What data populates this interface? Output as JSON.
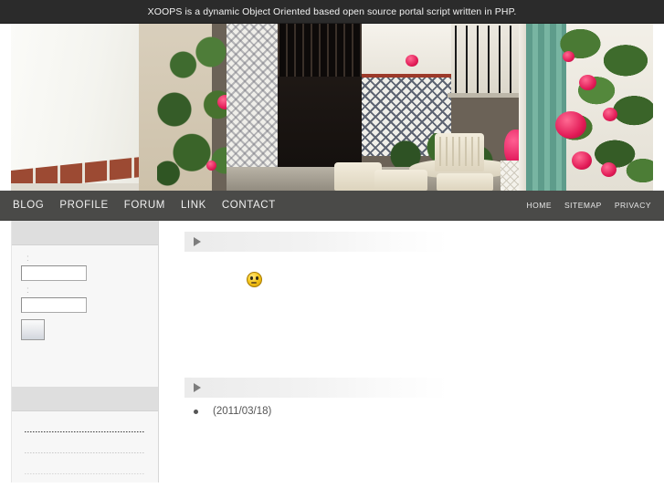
{
  "topbar": {
    "announcement": "XOOPS is a dynamic Object Oriented based open source portal script written in PHP."
  },
  "banner": {
    "alt": "patio-photo-banner",
    "description": "Patio with white plastic table and chairs, tiled wall, pink geranium and bougainvillea flowers"
  },
  "nav": {
    "primary": [
      {
        "label": "BLOG",
        "name": "nav-item-blog"
      },
      {
        "label": "PROFILE",
        "name": "nav-item-profile"
      },
      {
        "label": "FORUM",
        "name": "nav-item-forum"
      },
      {
        "label": "LINK",
        "name": "nav-item-link"
      },
      {
        "label": "CONTACT",
        "name": "nav-item-contact"
      }
    ],
    "secondary": [
      {
        "label": "HOME",
        "name": "nav-item-home"
      },
      {
        "label": "SITEMAP",
        "name": "nav-item-sitemap"
      },
      {
        "label": "PRIVACY",
        "name": "nav-item-privacy"
      }
    ]
  },
  "sidebar": {
    "login_block": {
      "title": "",
      "username_label": ":",
      "username_value": "",
      "username_placeholder": "",
      "password_label": ":",
      "password_value": "",
      "password_placeholder": "",
      "submit_label": ""
    },
    "links_block": {
      "title": ""
    }
  },
  "main": {
    "article_block": {
      "title": "",
      "body_text": "",
      "emoticon": "smiley-face"
    },
    "news_block": {
      "title": "",
      "items": [
        {
          "title": "",
          "date": "(2011/03/18)"
        }
      ]
    }
  },
  "colors": {
    "topbar_bg": "#2b2b2b",
    "nav_bg": "#4a4a48",
    "block_head_bg": "#dedede",
    "block_body_bg": "#f7f7f7",
    "page_bg": "#ffffff"
  }
}
